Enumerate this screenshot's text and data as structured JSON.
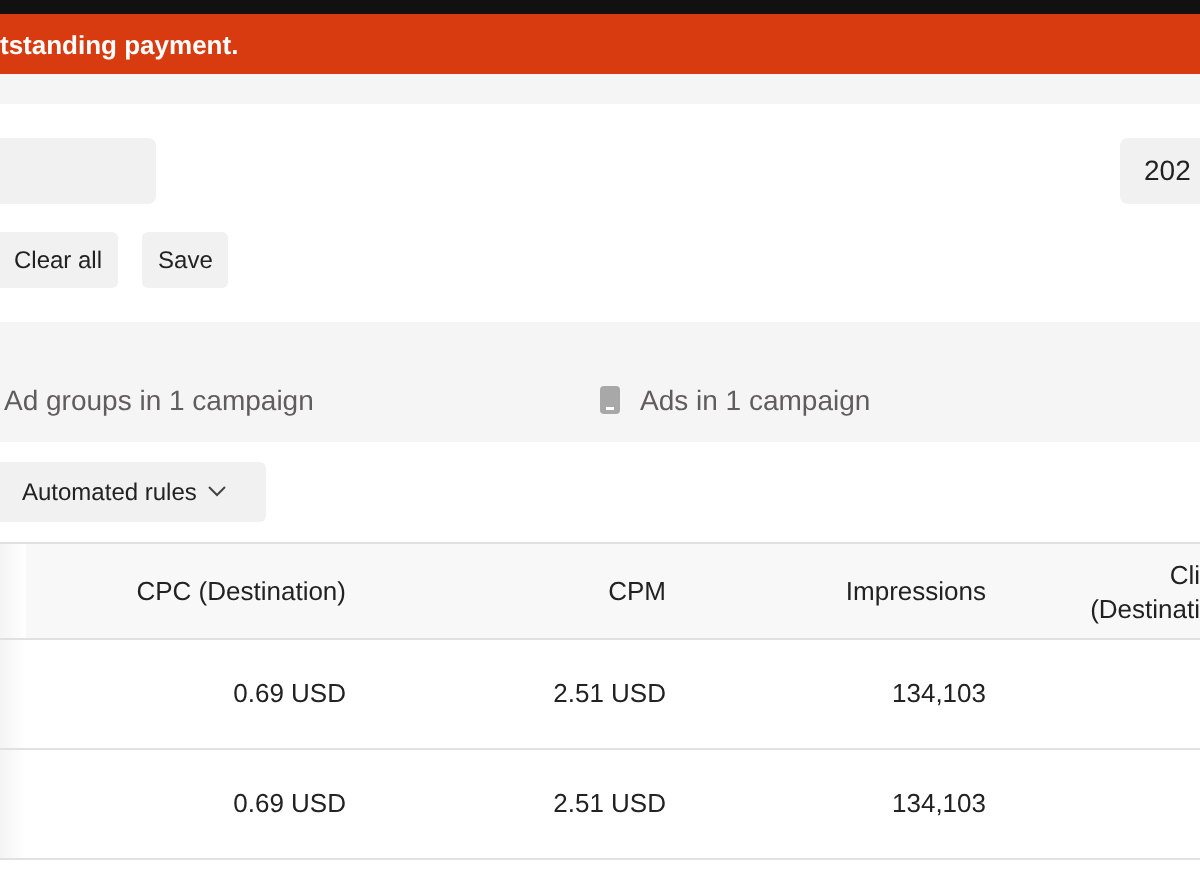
{
  "banner": {
    "text": "tstanding payment."
  },
  "toolbar": {
    "date_field": {
      "value": "202"
    }
  },
  "filter_buttons": [
    "Clear all",
    "Save"
  ],
  "levels": [
    {
      "label": "Ad groups in 1 campaign",
      "kind": "plain",
      "selected": false
    },
    {
      "label": "Ads in 1 campaign",
      "kind": "phone",
      "selected": false
    }
  ],
  "rules_button": {
    "label": "Automated rules"
  },
  "table": {
    "columns": [
      "CPC (Destination)",
      "CPM",
      "Impressions"
    ],
    "cut_column": [
      "Cli",
      "(Destinati"
    ],
    "rows": [
      {
        "cells": [
          "0.69 USD",
          "2.51 USD",
          "134,103"
        ]
      },
      {
        "cells": [
          "0.69 USD",
          "2.51 USD",
          "134,103"
        ]
      }
    ]
  }
}
